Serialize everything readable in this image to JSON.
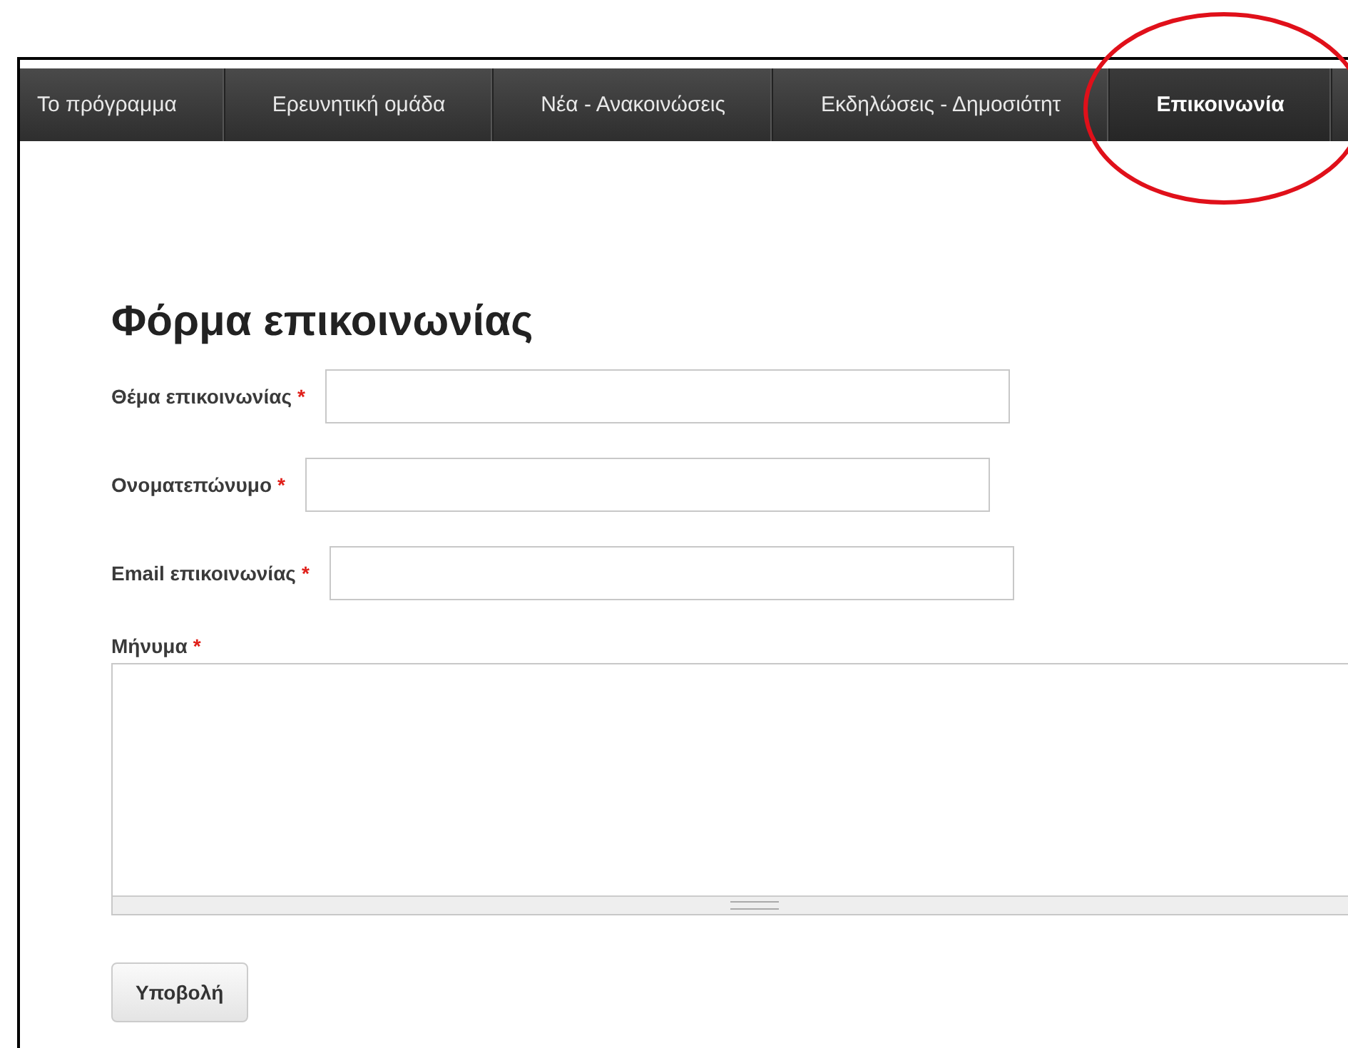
{
  "nav": {
    "items": [
      {
        "label": "Το πρόγραμμα",
        "selected": false
      },
      {
        "label": "Ερευνητική ομάδα",
        "selected": false
      },
      {
        "label": "Νέα - Ανακοινώσεις",
        "selected": false
      },
      {
        "label": "Εκδηλώσεις - Δημοσιότητ",
        "selected": false
      },
      {
        "label": "Επικοινωνία",
        "selected": true
      }
    ]
  },
  "form": {
    "title": "Φόρμα επικοινωνίας",
    "fields": [
      {
        "label": "Θέμα επικοινωνίας",
        "required": true,
        "kind": "text"
      },
      {
        "label": "Ονοματεπώνυμο",
        "required": true,
        "kind": "text"
      },
      {
        "label": "Email επικοινωνίας",
        "required": true,
        "kind": "text"
      },
      {
        "label": "Μήνυμα",
        "required": true,
        "kind": "textarea"
      }
    ],
    "required_mark": "*",
    "submit": "Υποβολή"
  }
}
